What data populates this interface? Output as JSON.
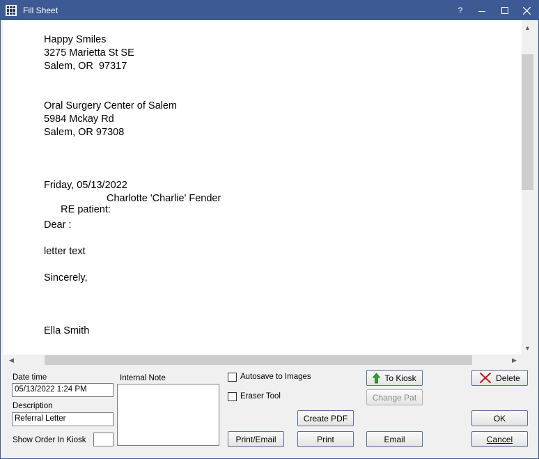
{
  "window": {
    "title": "Fill Sheet",
    "help": "?",
    "accent": "#3d5a94"
  },
  "sheet": {
    "sender": [
      "Happy Smiles",
      "3275 Marietta St SE",
      "Salem, OR  97317"
    ],
    "recipient": [
      "Oral Surgery Center of Salem",
      "5984 Mckay Rd",
      "Salem, OR 97308"
    ],
    "date_line": "Friday, 05/13/2022",
    "re_label": "RE patient:",
    "re_name": "Charlotte 'Charlie' Fender",
    "greeting": "Dear :",
    "body": "letter text",
    "closing": "Sincerely,",
    "signature": "Ella Smith"
  },
  "form": {
    "date_time_label": "Date time",
    "date_time_value": "05/13/2022 1:24 PM",
    "description_label": "Description",
    "description_value": "Referral Letter",
    "show_order_label": "Show Order In Kiosk",
    "show_order_value": "",
    "internal_note_label": "Internal Note",
    "internal_note_value": "",
    "autosave_label": "Autosave to Images",
    "eraser_label": "Eraser Tool"
  },
  "buttons": {
    "to_kiosk": "To Kiosk",
    "change_pat": "Change Pat",
    "delete": "Delete",
    "create_pdf": "Create PDF",
    "ok": "OK",
    "print_email": "Print/Email",
    "print": "Print",
    "email": "Email",
    "cancel": "Cancel"
  },
  "icons": {
    "to_kiosk": "arrow-up-icon",
    "delete": "x-icon"
  }
}
